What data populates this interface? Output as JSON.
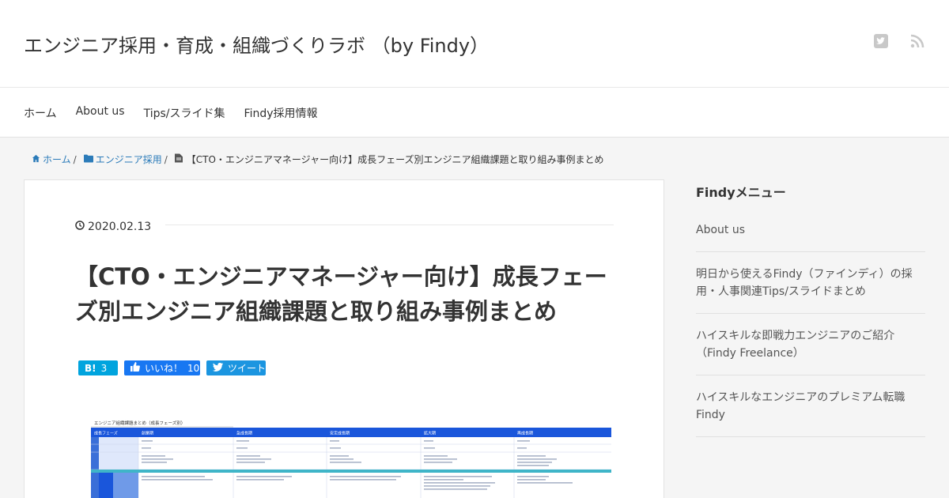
{
  "header": {
    "site_title": "エンジニア採用・育成・組織づくりラボ （by Findy）"
  },
  "nav": {
    "items": [
      "ホーム",
      "About us",
      "Tips/スライド集",
      "Findy採用情報"
    ]
  },
  "breadcrumb": {
    "home": "ホーム",
    "category": "エンジニア採用",
    "current": "【CTO・エンジニアマネージャー向け】成長フェーズ別エンジニア組織課題と取り組み事例まとめ",
    "separator": "/"
  },
  "post": {
    "date": "2020.02.13",
    "title": "【CTO・エンジニアマネージャー向け】成長フェーズ別エンジニア組織課題と取り組み事例まとめ",
    "share": {
      "hatena_label": "B!",
      "hatena_count": "3",
      "fb_label": "いいね！",
      "fb_count": "10",
      "tw_label": "ツイート"
    },
    "thumbnail": {
      "title": "エンジニア組織課題まとめ（成長フェーズ別）",
      "header_first": "成長フェーズ",
      "phases": [
        "創業期",
        "急成長期",
        "安定成長期",
        "拡大期",
        "再成長期"
      ]
    }
  },
  "sidebar": {
    "title": "Findyメニュー",
    "items": [
      "About us",
      "明日から使えるFindy（ファインディ）の採用・人事関連Tips/スライドまとめ",
      "ハイスキルな即戦力エンジニアのご紹介（Findy Freelance）",
      "ハイスキルなエンジニアのプレミアム転職Findy"
    ]
  },
  "colors": {
    "link": "#2b7bb9",
    "hatena": "#00a4de",
    "facebook": "#1877f2",
    "twitter": "#1b95e0",
    "thumb_header": "#1a56db",
    "thumb_teal": "#3fb5c8"
  },
  "icons": {
    "header": [
      "twitter-icon",
      "rss-icon"
    ],
    "breadcrumb": [
      "home-icon",
      "folder-icon",
      "file-icon"
    ],
    "date": "clock-icon"
  }
}
